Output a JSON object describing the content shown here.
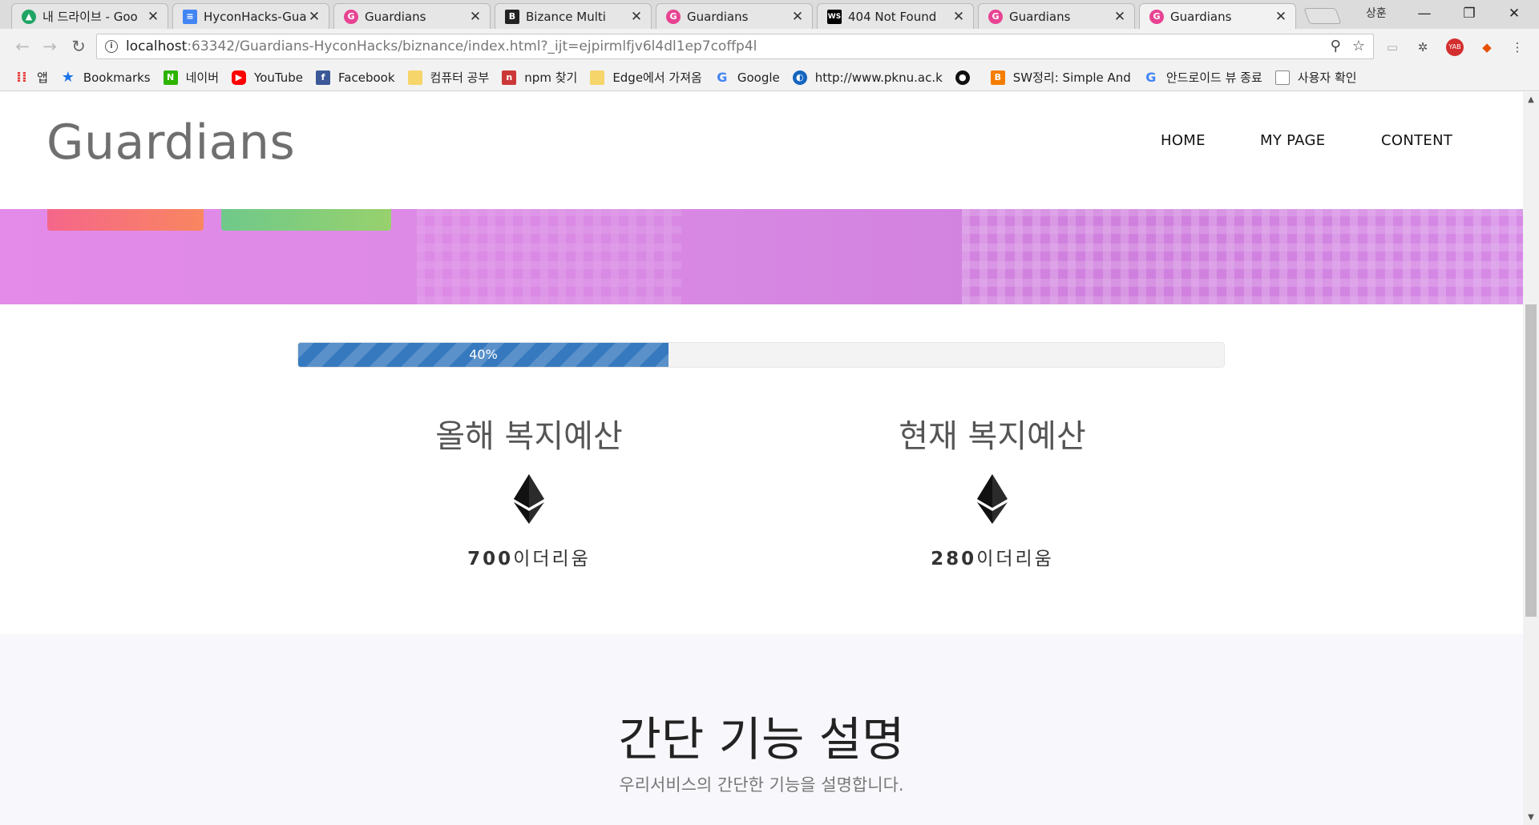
{
  "browser": {
    "tabs": [
      {
        "title": "내 드라이브 - Goo",
        "icon": "google-drive-icon",
        "color": "#1fa463"
      },
      {
        "title": "HyconHacks-Guarc",
        "icon": "google-docs-icon",
        "color": "#4285f4"
      },
      {
        "title": "Guardians",
        "icon": "guardians-icon",
        "color": "#e84393"
      },
      {
        "title": "Bizance Multi",
        "icon": "bizance-icon",
        "color": "#222222"
      },
      {
        "title": "Guardians",
        "icon": "guardians-icon",
        "color": "#e84393"
      },
      {
        "title": "404 Not Found",
        "icon": "webstorm-icon",
        "color": "#000000"
      },
      {
        "title": "Guardians",
        "icon": "guardians-icon",
        "color": "#e84393"
      },
      {
        "title": "Guardians",
        "icon": "guardians-icon",
        "color": "#e84393",
        "active": true
      }
    ],
    "profile_name": "상훈",
    "url_host": "localhost",
    "url_rest": ":63342/Guardians-HyconHacks/biznance/index.html?_ijt=ejpirmlfjv6l4dl1ep7coffp4l",
    "bookmarks": [
      {
        "label": "앱",
        "icon": "apps-grid-icon",
        "color": "#e53935"
      },
      {
        "label": "Bookmarks",
        "icon": "star-icon",
        "color": "#1a73e8"
      },
      {
        "label": "네이버",
        "icon": "naver-icon",
        "color": "#2db400"
      },
      {
        "label": "YouTube",
        "icon": "youtube-icon",
        "color": "#ff0000"
      },
      {
        "label": "Facebook",
        "icon": "facebook-icon",
        "color": "#3b5998"
      },
      {
        "label": "컴퓨터 공부",
        "icon": "folder-icon",
        "color": "#f6d56b"
      },
      {
        "label": "npm 찾기",
        "icon": "npm-icon",
        "color": "#cb3837"
      },
      {
        "label": "Edge에서 가져옴",
        "icon": "folder-icon",
        "color": "#f6d56b"
      },
      {
        "label": "Google",
        "icon": "google-icon",
        "color": "#4285f4"
      },
      {
        "label": "http://www.pknu.ac.k",
        "icon": "pknu-icon",
        "color": "#1565c0"
      },
      {
        "label": "",
        "icon": "github-icon",
        "color": "#111111"
      },
      {
        "label": "SW정리: Simple And",
        "icon": "blogger-icon",
        "color": "#f57d00"
      },
      {
        "label": "안드로이드 뷰 종료",
        "icon": "google-icon",
        "color": "#4285f4"
      },
      {
        "label": "사용자 확인",
        "icon": "page-icon",
        "color": "#888888"
      }
    ]
  },
  "site": {
    "logo": "Guardians",
    "nav": [
      "HOME",
      "MY PAGE",
      "CONTENT"
    ],
    "progress": {
      "percent": 40,
      "label": "40%",
      "color": "#3679be"
    },
    "budgets": [
      {
        "title": "올해 복지예산",
        "amount": "700",
        "unit": "이더리움",
        "icon": "ethereum-icon"
      },
      {
        "title": "현재 복지예산",
        "amount": "280",
        "unit": "이더리움",
        "icon": "ethereum-icon"
      }
    ],
    "features": {
      "title": "간단 기능 설명",
      "subtitle": "우리서비스의 간단한 기능을 설명합니다."
    },
    "colors": {
      "hero": "#d98ae4",
      "button_red": "#f25f74",
      "button_green": "#7acb7d"
    }
  }
}
